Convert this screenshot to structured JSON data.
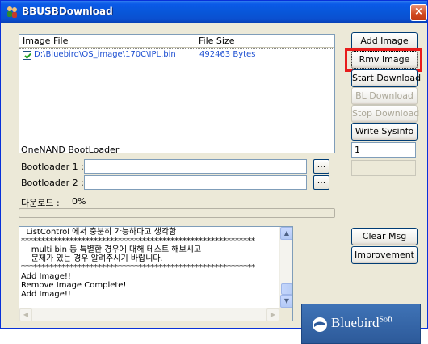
{
  "window": {
    "title": "BBUSBDownload",
    "close_glyph": "×"
  },
  "list": {
    "columns": [
      "Image File",
      "File Size"
    ],
    "rows": [
      {
        "checked": true,
        "path": "D:\\Bluebird\\OS_image\\170C\\IPL.bin",
        "size": "492463 Bytes"
      }
    ]
  },
  "buttons": {
    "add_image": "Add Image",
    "remove_image": "Rmv Image",
    "start_download": "Start Download",
    "bl_download": "BL Download",
    "stop_download": "Stop Download",
    "write_sysinfo": "Write Sysinfo",
    "clear_msg": "Clear Msg",
    "improvement": "Improvement",
    "browse": "..."
  },
  "side_fields": {
    "field1_value": "1",
    "field2_value": ""
  },
  "bootloader": {
    "group_label": "OneNAND BootLoader",
    "label1": "Bootloader 1 :",
    "label2": "Bootloader 2 :",
    "value1": "",
    "value2": ""
  },
  "download": {
    "label": "다운로드 :",
    "percent_text": "0%",
    "progress": 0
  },
  "log": {
    "lines": [
      "  ListControl 에서 충분히 가능하다고 생각함",
      "**********************************************************",
      "    multi bin 등 특별한 경우에 대해 테스트 해보시고",
      "    문제가 있는 경우 알려주시기 바랍니다.",
      "**********************************************************",
      "Add Image!!",
      "Remove Image Complete!!",
      "Add Image!!"
    ]
  },
  "logo": {
    "brand": "Bluebird",
    "brand_sup": "Soft",
    "color": "#3a6db0"
  },
  "icons": {
    "app": "people-icon",
    "checkbox": "check-icon",
    "logo": "bluebird-logo-icon"
  }
}
